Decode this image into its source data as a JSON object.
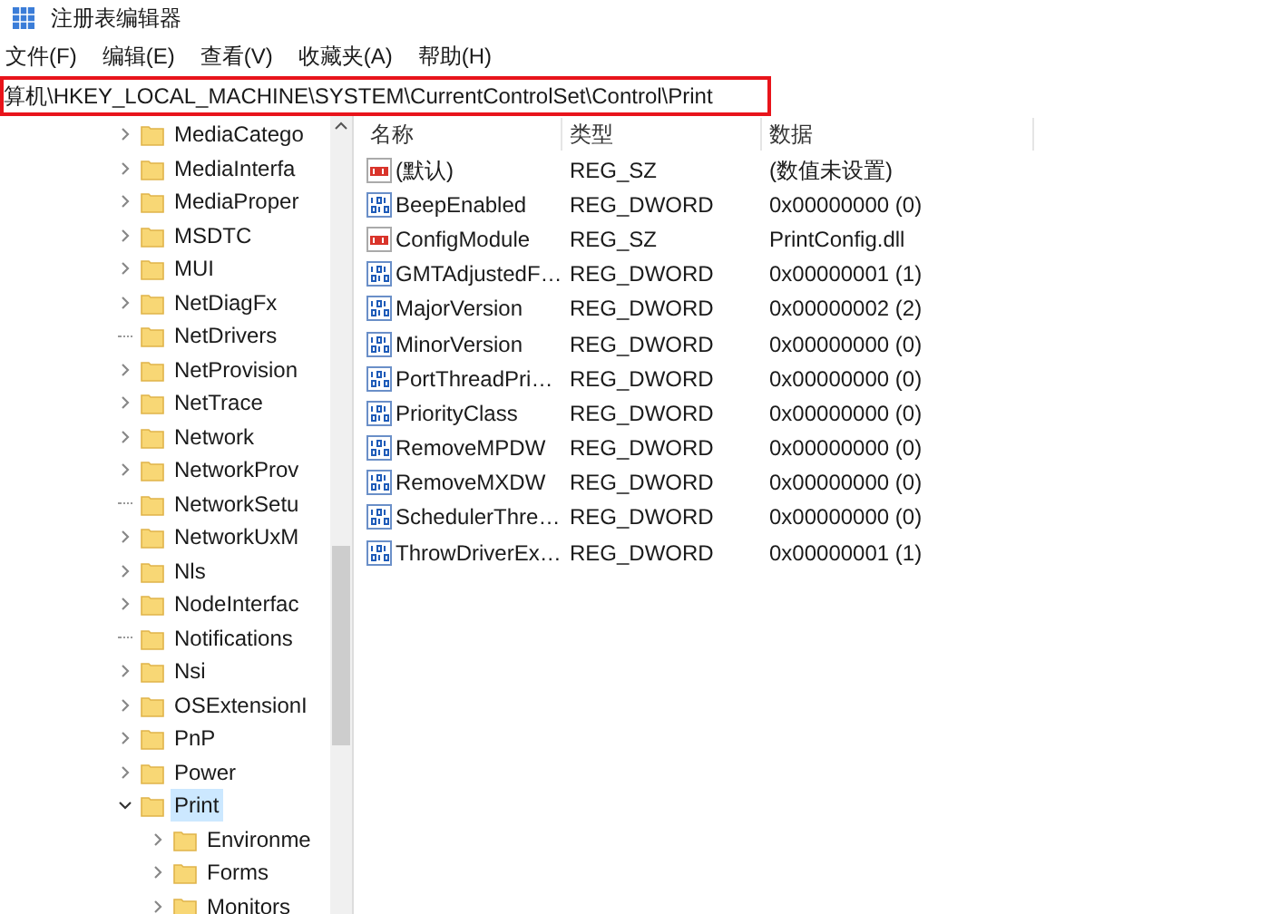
{
  "window": {
    "title": "注册表编辑器"
  },
  "menu": [
    "文件(F)",
    "编辑(E)",
    "查看(V)",
    "收藏夹(A)",
    "帮助(H)"
  ],
  "address_bar": {
    "value": "算机\\HKEY_LOCAL_MACHINE\\SYSTEM\\CurrentControlSet\\Control\\Print",
    "highlighted": true
  },
  "tree": [
    {
      "label": "MediaCatego",
      "has_children": true,
      "expanded": false,
      "selected": false
    },
    {
      "label": "MediaInterfa",
      "has_children": true,
      "expanded": false,
      "selected": false
    },
    {
      "label": "MediaProper",
      "has_children": true,
      "expanded": false,
      "selected": false
    },
    {
      "label": "MSDTC",
      "has_children": true,
      "expanded": false,
      "selected": false
    },
    {
      "label": "MUI",
      "has_children": true,
      "expanded": false,
      "selected": false
    },
    {
      "label": "NetDiagFx",
      "has_children": true,
      "expanded": false,
      "selected": false
    },
    {
      "label": "NetDrivers",
      "has_children": false,
      "selected": false
    },
    {
      "label": "NetProvision",
      "has_children": true,
      "expanded": false,
      "selected": false
    },
    {
      "label": "NetTrace",
      "has_children": true,
      "expanded": false,
      "selected": false
    },
    {
      "label": "Network",
      "has_children": true,
      "expanded": false,
      "selected": false
    },
    {
      "label": "NetworkProv",
      "has_children": true,
      "expanded": false,
      "selected": false
    },
    {
      "label": "NetworkSetu",
      "has_children": false,
      "selected": false
    },
    {
      "label": "NetworkUxM",
      "has_children": true,
      "expanded": false,
      "selected": false
    },
    {
      "label": "Nls",
      "has_children": true,
      "expanded": false,
      "selected": false
    },
    {
      "label": "NodeInterfac",
      "has_children": true,
      "expanded": false,
      "selected": false
    },
    {
      "label": "Notifications",
      "has_children": false,
      "selected": false
    },
    {
      "label": "Nsi",
      "has_children": true,
      "expanded": false,
      "selected": false
    },
    {
      "label": "OSExtensionI",
      "has_children": true,
      "expanded": false,
      "selected": false
    },
    {
      "label": "PnP",
      "has_children": true,
      "expanded": false,
      "selected": false
    },
    {
      "label": "Power",
      "has_children": true,
      "expanded": false,
      "selected": false
    },
    {
      "label": "Print",
      "has_children": true,
      "expanded": true,
      "selected": true,
      "children": [
        {
          "label": "Environme",
          "has_children": true,
          "expanded": false,
          "selected": false
        },
        {
          "label": "Forms",
          "has_children": true,
          "expanded": false,
          "selected": false
        },
        {
          "label": "Monitors",
          "has_children": true,
          "expanded": false,
          "selected": false
        }
      ]
    }
  ],
  "values_table": {
    "columns": [
      "名称",
      "类型",
      "数据"
    ],
    "rows": [
      {
        "kind": "sz",
        "name": "(默认)",
        "type": "REG_SZ",
        "data": "(数值未设置)"
      },
      {
        "kind": "dword",
        "name": "BeepEnabled",
        "type": "REG_DWORD",
        "data": "0x00000000 (0)"
      },
      {
        "kind": "sz",
        "name": "ConfigModule",
        "type": "REG_SZ",
        "data": "PrintConfig.dll"
      },
      {
        "kind": "dword",
        "name": "GMTAdjustedF…",
        "type": "REG_DWORD",
        "data": "0x00000001 (1)"
      },
      {
        "kind": "dword",
        "name": "MajorVersion",
        "type": "REG_DWORD",
        "data": "0x00000002 (2)"
      },
      {
        "kind": "dword",
        "name": "MinorVersion",
        "type": "REG_DWORD",
        "data": "0x00000000 (0)"
      },
      {
        "kind": "dword",
        "name": "PortThreadPri…",
        "type": "REG_DWORD",
        "data": "0x00000000 (0)"
      },
      {
        "kind": "dword",
        "name": "PriorityClass",
        "type": "REG_DWORD",
        "data": "0x00000000 (0)"
      },
      {
        "kind": "dword",
        "name": "RemoveMPDW",
        "type": "REG_DWORD",
        "data": "0x00000000 (0)"
      },
      {
        "kind": "dword",
        "name": "RemoveMXDW",
        "type": "REG_DWORD",
        "data": "0x00000000 (0)"
      },
      {
        "kind": "dword",
        "name": "SchedulerThre…",
        "type": "REG_DWORD",
        "data": "0x00000000 (0)"
      },
      {
        "kind": "dword",
        "name": "ThrowDriverEx…",
        "type": "REG_DWORD",
        "data": "0x00000001 (1)"
      }
    ]
  }
}
